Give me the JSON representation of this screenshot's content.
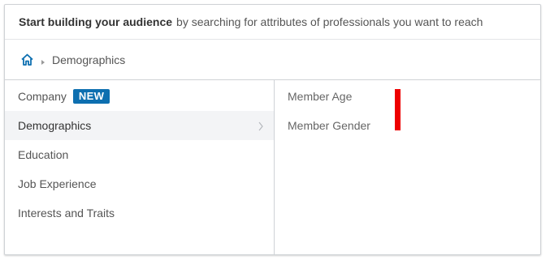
{
  "header": {
    "bold_text": "Start building your audience",
    "rest_text": "by searching for attributes of professionals you want to reach"
  },
  "breadcrumb": {
    "home_icon": "home-icon",
    "current": "Demographics"
  },
  "categories": [
    {
      "label": "Company",
      "badge": "NEW"
    },
    {
      "label": "Demographics"
    },
    {
      "label": "Education"
    },
    {
      "label": "Job Experience"
    },
    {
      "label": "Interests and Traits"
    }
  ],
  "options": [
    {
      "label": "Member Age"
    },
    {
      "label": "Member Gender"
    }
  ],
  "colors": {
    "accent": "#0d6fb0",
    "badge_bg": "#0d6fb0",
    "annotation_bar": "#ee0000",
    "active_row_bg": "#f3f4f6"
  }
}
